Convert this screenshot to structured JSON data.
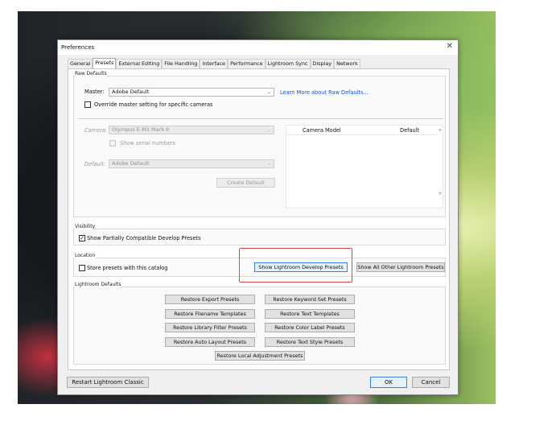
{
  "dialog": {
    "title": "Preferences",
    "tabs": [
      "General",
      "Presets",
      "External Editing",
      "File Handling",
      "Interface",
      "Performance",
      "Lightroom Sync",
      "Display",
      "Network"
    ],
    "active_tab": "Presets"
  },
  "raw_defaults": {
    "group_label": "Raw Defaults",
    "master_label": "Master:",
    "master_value": "Adobe Default",
    "learn_more_link": "Learn More about Raw Defaults...",
    "override_label": "Override master setting for specific cameras",
    "override_checked": false,
    "camera_label": "Camera:",
    "camera_value": "Olympus E-M1 Mark II",
    "serial_label": "Show serial numbers",
    "default_label": "Default:",
    "default_value": "Adobe Default",
    "create_default_button": "Create Default",
    "table_headers": [
      "Camera Model",
      "Default"
    ]
  },
  "visibility": {
    "group_label": "Visibility",
    "show_partially_label": "Show Partially Compatible Develop Presets",
    "show_partially_checked": true
  },
  "location": {
    "group_label": "Location",
    "store_label": "Store presets with this catalog",
    "store_checked": false,
    "show_develop_button": "Show Lightroom Develop Presets",
    "show_other_button": "Show All Other Lightroom Presets"
  },
  "lightroom_defaults": {
    "group_label": "Lightroom Defaults",
    "buttons_left": [
      "Restore Export Presets",
      "Restore Filename Templates",
      "Restore Library Filter Presets",
      "Restore Auto Layout Presets"
    ],
    "buttons_right": [
      "Restore Keyword Set Presets",
      "Restore Text Templates",
      "Restore Color Label Presets",
      "Restore Text Style Presets"
    ],
    "button_bottom": "Restore Local Adjustment Presets"
  },
  "footer": {
    "restart_button": "Restart Lightroom Classic",
    "ok_button": "OK",
    "cancel_button": "Cancel"
  },
  "colors": {
    "highlight": "#d9484a",
    "link": "#1e54c8",
    "focus": "#3c7fd9"
  }
}
